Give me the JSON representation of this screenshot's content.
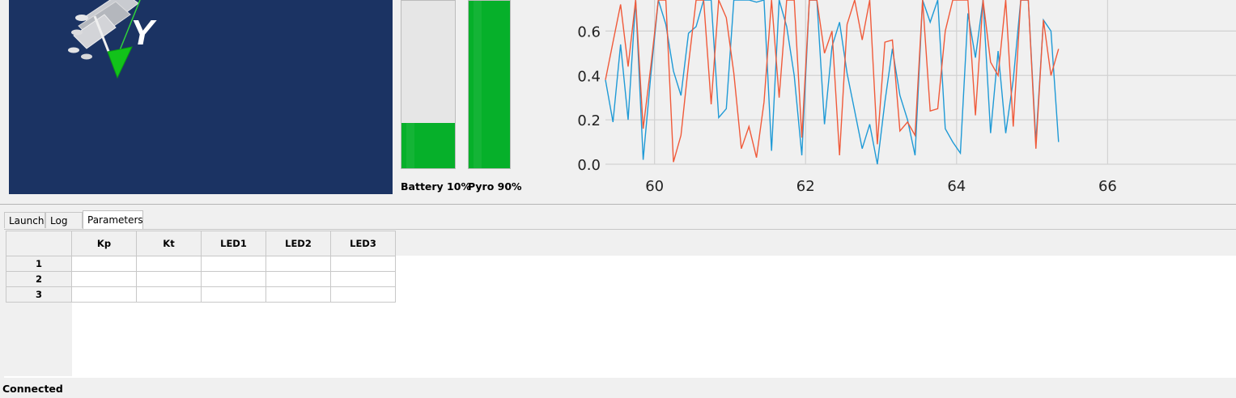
{
  "viewport": {
    "axis_label": "Y",
    "background": "#1b3363"
  },
  "gauges": {
    "battery": {
      "label": "Battery 10%",
      "level": 0.27,
      "color": "#06b02a"
    },
    "pyro": {
      "label": "Pyro 90%",
      "level": 1.0,
      "color": "#06b02a"
    }
  },
  "chart_data": {
    "type": "line",
    "title": "",
    "xlabel": "",
    "ylabel": "",
    "xlim": [
      59.35,
      67.7
    ],
    "ylim": [
      0.0,
      0.74
    ],
    "x_ticks": [
      60,
      62,
      64,
      66
    ],
    "y_ticks": [
      0.0,
      0.2,
      0.4,
      0.6
    ],
    "grid": true,
    "series": [
      {
        "color": "#1f9ad6",
        "x": [
          59.35,
          59.45,
          59.55,
          59.65,
          59.75,
          59.85,
          59.95,
          60.05,
          60.15,
          60.25,
          60.35,
          60.45,
          60.55,
          60.65,
          60.75,
          60.85,
          60.95,
          61.05,
          61.15,
          61.25,
          61.35,
          61.45,
          61.55,
          61.65,
          61.75,
          61.85,
          61.95,
          62.05,
          62.15,
          62.25,
          62.35,
          62.45,
          62.55,
          62.65,
          62.75,
          62.85,
          62.95,
          63.05,
          63.15,
          63.25,
          63.35,
          63.45,
          63.55,
          63.65,
          63.75,
          63.85,
          63.95,
          64.05,
          64.15,
          64.25,
          64.35,
          64.45,
          64.55,
          64.65,
          64.75,
          64.85,
          64.95,
          65.05,
          65.15,
          65.25,
          65.35
        ],
        "values": [
          0.38,
          0.19,
          0.54,
          0.2,
          0.74,
          0.02,
          0.4,
          0.74,
          0.63,
          0.42,
          0.31,
          0.59,
          0.62,
          0.74,
          0.74,
          0.21,
          0.25,
          0.74,
          0.74,
          0.74,
          0.73,
          0.74,
          0.06,
          0.74,
          0.62,
          0.4,
          0.04,
          0.74,
          0.74,
          0.18,
          0.53,
          0.64,
          0.41,
          0.24,
          0.07,
          0.18,
          0.0,
          0.28,
          0.52,
          0.31,
          0.2,
          0.04,
          0.74,
          0.64,
          0.74,
          0.16,
          0.1,
          0.05,
          0.68,
          0.48,
          0.74,
          0.14,
          0.51,
          0.14,
          0.38,
          0.74,
          0.74,
          0.1,
          0.65,
          0.6,
          0.1
        ]
      },
      {
        "color": "#f05a3a",
        "x": [
          59.35,
          59.45,
          59.55,
          59.65,
          59.75,
          59.85,
          59.95,
          60.05,
          60.15,
          60.25,
          60.35,
          60.45,
          60.55,
          60.65,
          60.75,
          60.85,
          60.95,
          61.05,
          61.15,
          61.25,
          61.35,
          61.45,
          61.55,
          61.65,
          61.75,
          61.85,
          61.95,
          62.05,
          62.15,
          62.25,
          62.35,
          62.45,
          62.55,
          62.65,
          62.75,
          62.85,
          62.95,
          63.05,
          63.15,
          63.25,
          63.35,
          63.45,
          63.55,
          63.65,
          63.75,
          63.85,
          63.95,
          64.05,
          64.15,
          64.25,
          64.35,
          64.45,
          64.55,
          64.65,
          64.75,
          64.85,
          64.95,
          65.05,
          65.15,
          65.25,
          65.35
        ],
        "values": [
          0.38,
          0.55,
          0.72,
          0.44,
          0.74,
          0.16,
          0.44,
          0.74,
          0.74,
          0.01,
          0.13,
          0.45,
          0.74,
          0.74,
          0.27,
          0.74,
          0.66,
          0.41,
          0.07,
          0.17,
          0.03,
          0.28,
          0.74,
          0.3,
          0.74,
          0.74,
          0.12,
          0.74,
          0.74,
          0.5,
          0.6,
          0.04,
          0.63,
          0.74,
          0.56,
          0.74,
          0.09,
          0.55,
          0.56,
          0.15,
          0.19,
          0.13,
          0.74,
          0.24,
          0.25,
          0.6,
          0.74,
          0.74,
          0.74,
          0.22,
          0.74,
          0.46,
          0.4,
          0.74,
          0.17,
          0.74,
          0.74,
          0.07,
          0.65,
          0.4,
          0.52
        ]
      }
    ]
  },
  "tabs": [
    {
      "label": "Launch",
      "active": false
    },
    {
      "label": "Log",
      "active": false
    },
    {
      "label": "Parameters",
      "active": true
    }
  ],
  "parameters_table": {
    "columns": [
      "Kp",
      "Kt",
      "LED1",
      "LED2",
      "LED3"
    ],
    "rows": [
      {
        "label": "1",
        "cells": [
          "",
          "",
          "",
          "",
          ""
        ]
      },
      {
        "label": "2",
        "cells": [
          "",
          "",
          "",
          "",
          ""
        ]
      },
      {
        "label": "3",
        "cells": [
          "",
          "",
          "",
          "",
          ""
        ]
      }
    ]
  },
  "status_bar": {
    "text": "Connected"
  }
}
